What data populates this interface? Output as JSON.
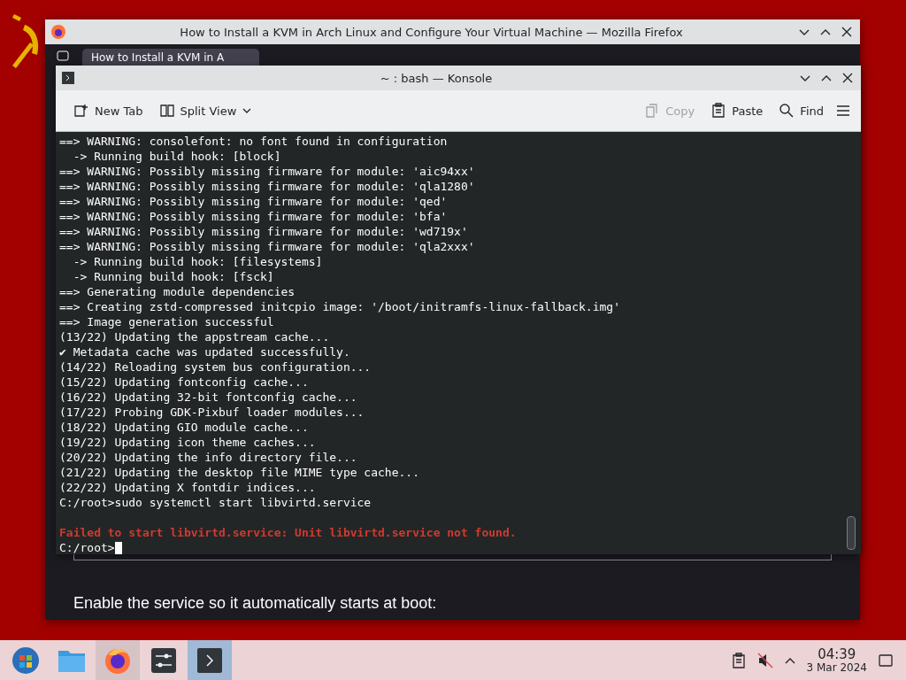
{
  "firefox": {
    "title": "How to Install a KVM in Arch Linux and Configure Your Virtual Machine — Mozilla Firefox",
    "tab": {
      "label": "How to Install a KVM in A",
      "selected": true
    },
    "paragraph": "Enable the service so it automatically starts at boot:"
  },
  "konsole": {
    "title": "~ : bash — Konsole",
    "toolbar": [
      {
        "kind": "new-tab",
        "label": "New Tab",
        "disabled": false
      },
      {
        "kind": "split",
        "label": "Split View",
        "disabled": false
      },
      {
        "kind": "copy",
        "label": "Copy",
        "disabled": true
      },
      {
        "kind": "paste",
        "label": "Paste",
        "disabled": false
      },
      {
        "kind": "find",
        "label": "Find",
        "disabled": false
      }
    ],
    "lines": [
      {
        "kind": "text",
        "text": "==> WARNING: consolefont: no font found in configuration"
      },
      {
        "kind": "text",
        "text": "  -> Running build hook: [block]"
      },
      {
        "kind": "text",
        "text": "==> WARNING: Possibly missing firmware for module: 'aic94xx'"
      },
      {
        "kind": "text",
        "text": "==> WARNING: Possibly missing firmware for module: 'qla1280'"
      },
      {
        "kind": "text",
        "text": "==> WARNING: Possibly missing firmware for module: 'qed'"
      },
      {
        "kind": "text",
        "text": "==> WARNING: Possibly missing firmware for module: 'bfa'"
      },
      {
        "kind": "text",
        "text": "==> WARNING: Possibly missing firmware for module: 'wd719x'"
      },
      {
        "kind": "text",
        "text": "==> WARNING: Possibly missing firmware for module: 'qla2xxx'"
      },
      {
        "kind": "text",
        "text": "  -> Running build hook: [filesystems]"
      },
      {
        "kind": "text",
        "text": "  -> Running build hook: [fsck]"
      },
      {
        "kind": "text",
        "text": "==> Generating module dependencies"
      },
      {
        "kind": "text",
        "text": "==> Creating zstd-compressed initcpio image: '/boot/initramfs-linux-fallback.img'"
      },
      {
        "kind": "text",
        "text": "==> Image generation successful"
      },
      {
        "kind": "text",
        "text": "(13/22) Updating the appstream cache..."
      },
      {
        "kind": "text",
        "text": "✔ Metadata cache was updated successfully."
      },
      {
        "kind": "text",
        "text": "(14/22) Reloading system bus configuration..."
      },
      {
        "kind": "text",
        "text": "(15/22) Updating fontconfig cache..."
      },
      {
        "kind": "text",
        "text": "(16/22) Updating 32-bit fontconfig cache..."
      },
      {
        "kind": "text",
        "text": "(17/22) Probing GDK-Pixbuf loader modules..."
      },
      {
        "kind": "text",
        "text": "(18/22) Updating GIO module cache..."
      },
      {
        "kind": "text",
        "text": "(19/22) Updating icon theme caches..."
      },
      {
        "kind": "text",
        "text": "(20/22) Updating the info directory file..."
      },
      {
        "kind": "text",
        "text": "(21/22) Updating the desktop file MIME type cache..."
      },
      {
        "kind": "text",
        "text": "(22/22) Updating X fontdir indices..."
      },
      {
        "kind": "text",
        "text": "C:/root>sudo systemctl start libvirtd.service"
      },
      {
        "kind": "blank"
      },
      {
        "kind": "error",
        "text": "Failed to start libvirtd.service: Unit libvirtd.service not found."
      },
      {
        "kind": "prompt",
        "text": "C:/root>"
      }
    ]
  },
  "taskbar": {
    "apps": [
      {
        "kind": "start",
        "running": false,
        "selected": false
      },
      {
        "kind": "files",
        "running": false,
        "selected": false
      },
      {
        "kind": "firefox",
        "running": true,
        "selected": false
      },
      {
        "kind": "mixer",
        "running": false,
        "selected": false
      },
      {
        "kind": "terminal",
        "running": true,
        "selected": true
      }
    ],
    "clock": {
      "time": "04:39",
      "date": "3 Mar 2024"
    }
  }
}
